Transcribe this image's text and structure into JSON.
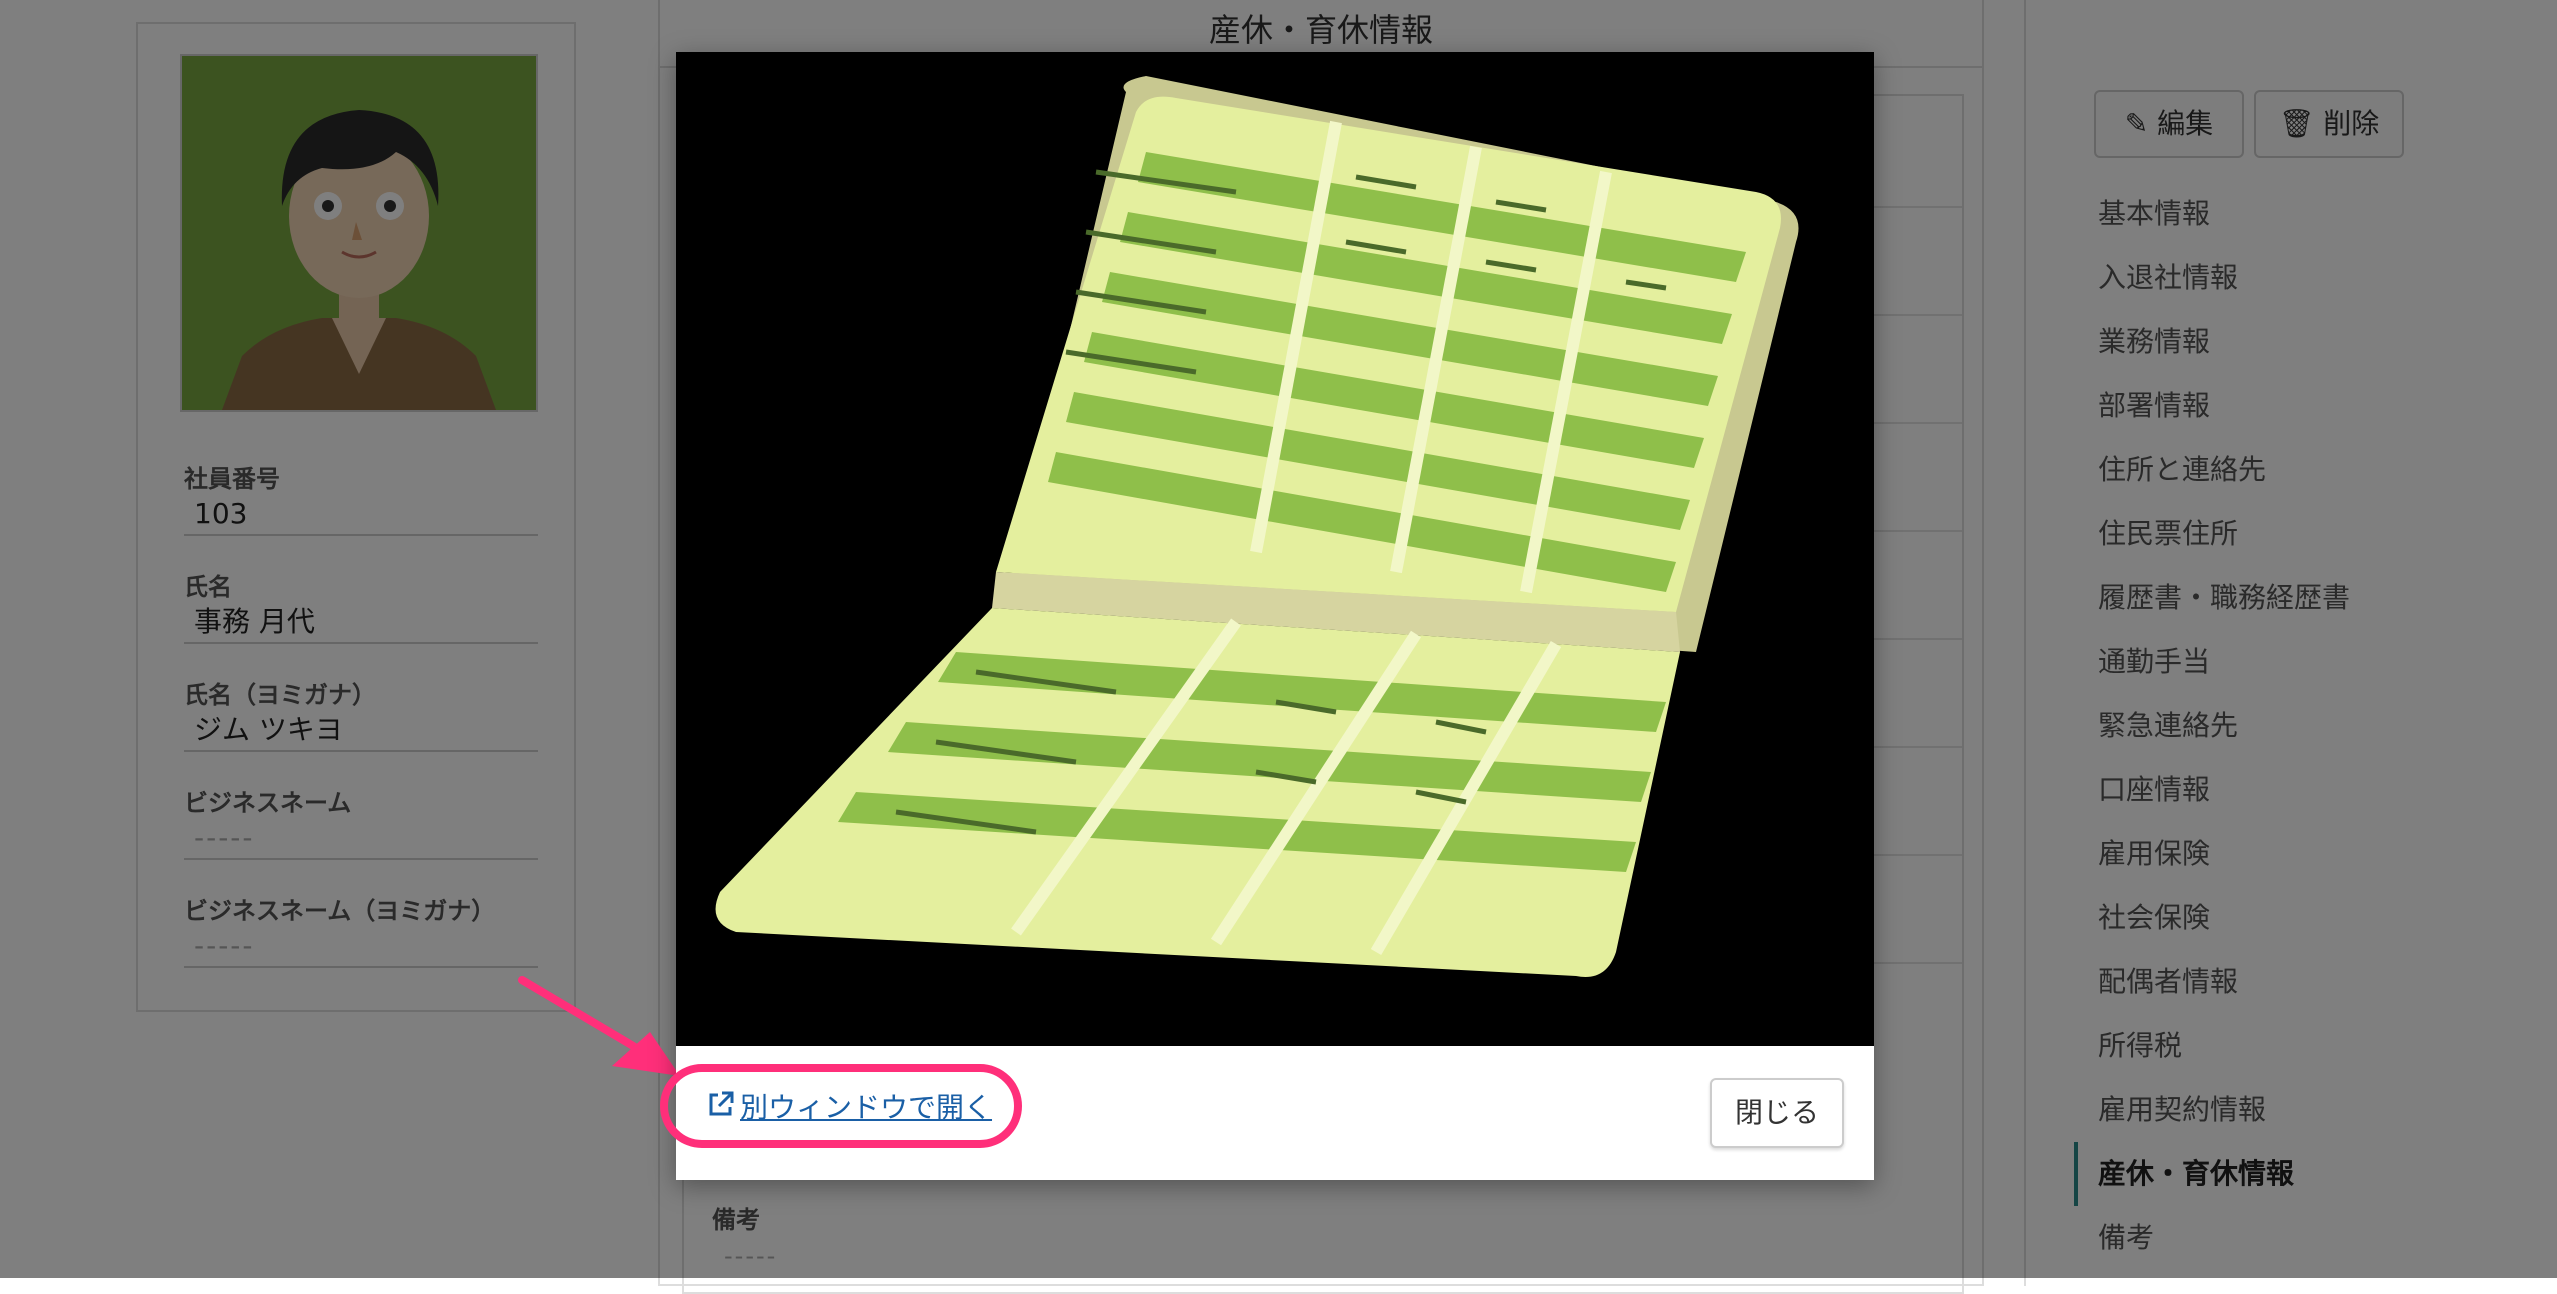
{
  "profile": {
    "fields": [
      {
        "label": "社員番号",
        "value": "103"
      },
      {
        "label": "氏名",
        "value": "事務 月代"
      },
      {
        "label": "氏名（ヨミガナ）",
        "value": "ジム ツキヨ"
      },
      {
        "label": "ビジネスネーム",
        "value": "-----"
      },
      {
        "label": "ビジネスネーム（ヨミガナ）",
        "value": "-----"
      }
    ]
  },
  "center": {
    "title": "産休・育休情報",
    "remarks_label": "備考",
    "remarks_value": "-----"
  },
  "actions": {
    "edit_label": "編集",
    "delete_label": "削除"
  },
  "nav": {
    "items": [
      "基本情報",
      "入退社情報",
      "業務情報",
      "部署情報",
      "住所と連絡先",
      "住民票住所",
      "履歴書・職務経歴書",
      "通勤手当",
      "緊急連絡先",
      "口座情報",
      "雇用保険",
      "社会保険",
      "配偶者情報",
      "所得税",
      "雇用契約情報",
      "産休・育休情報",
      "備考"
    ],
    "active_index": 15
  },
  "modal": {
    "open_new_window_label": "別ウィンドウで開く",
    "close_label": "閉じる",
    "image_subject": "passbook-illustration",
    "highlight_color": "#ff2f7a"
  }
}
